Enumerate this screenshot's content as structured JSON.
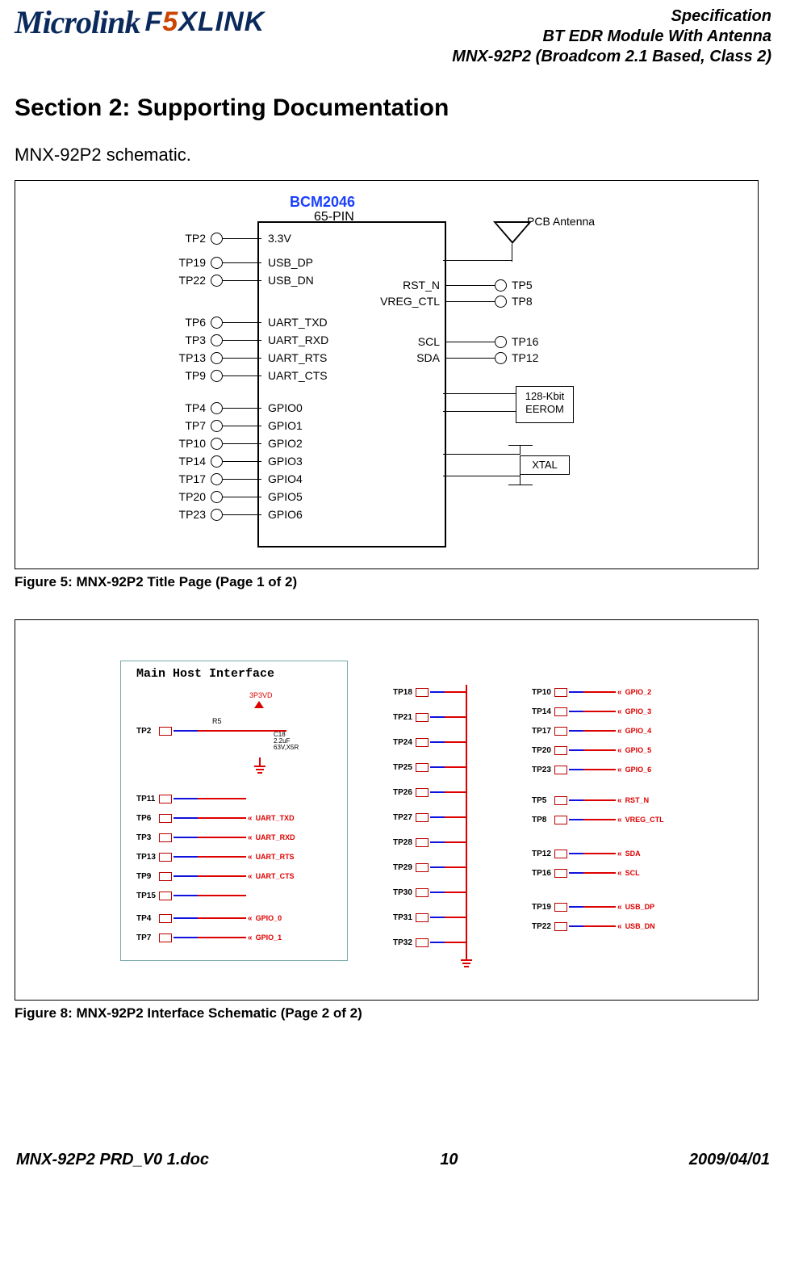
{
  "header": {
    "logo1": "Microlink",
    "logo2_prefix": "F",
    "logo2_5": "5",
    "logo2_suffix": "XLINK",
    "line1": "Specification",
    "line2": "BT EDR Module With Antenna",
    "line3": "MNX-92P2 (Broadcom 2.1  Based, Class 2)"
  },
  "section_title": "Section 2: Supporting Documentation",
  "subhead": "MNX-92P2 schematic.",
  "fig1": {
    "chip_title": "BCM2046",
    "chip_sub": "65-PIN",
    "ant_label": "PCB Antenna",
    "left_pins": [
      {
        "tp": "TP2",
        "name": "3.3V"
      },
      {
        "tp": "TP19",
        "name": "USB_DP"
      },
      {
        "tp": "TP22",
        "name": "USB_DN"
      },
      {
        "tp": "TP6",
        "name": "UART_TXD"
      },
      {
        "tp": "TP3",
        "name": "UART_RXD"
      },
      {
        "tp": "TP13",
        "name": "UART_RTS"
      },
      {
        "tp": "TP9",
        "name": "UART_CTS"
      },
      {
        "tp": "TP4",
        "name": "GPIO0"
      },
      {
        "tp": "TP7",
        "name": "GPIO1"
      },
      {
        "tp": "TP10",
        "name": "GPIO2"
      },
      {
        "tp": "TP14",
        "name": "GPIO3"
      },
      {
        "tp": "TP17",
        "name": "GPIO4"
      },
      {
        "tp": "TP20",
        "name": "GPIO5"
      },
      {
        "tp": "TP23",
        "name": "GPIO6"
      }
    ],
    "right_pins": [
      {
        "name": "RST_N",
        "tp": "TP5"
      },
      {
        "name": "VREG_CTL",
        "tp": "TP8"
      },
      {
        "name": "SCL",
        "tp": "TP16"
      },
      {
        "name": "SDA",
        "tp": "TP12"
      }
    ],
    "eerom": "128-Kbit\nEEROM",
    "xtal": "XTAL",
    "caption": "Figure 5: MNX-92P2 Title Page (Page 1 of 2)"
  },
  "fig2": {
    "box_title": "Main Host Interface",
    "r_label": "R5",
    "v_label": "3P3VD",
    "cap_label": "C18\n2.2uF\n63V,X5R",
    "col1": [
      {
        "tp": "TP2",
        "sig": ""
      },
      {
        "tp": "TP11",
        "sig": ""
      },
      {
        "tp": "TP6",
        "sig": "UART_TXD"
      },
      {
        "tp": "TP3",
        "sig": "UART_RXD"
      },
      {
        "tp": "TP13",
        "sig": "UART_RTS"
      },
      {
        "tp": "TP9",
        "sig": "UART_CTS"
      },
      {
        "tp": "TP15",
        "sig": ""
      },
      {
        "tp": "TP4",
        "sig": "GPIO_0"
      },
      {
        "tp": "TP7",
        "sig": "GPIO_1"
      }
    ],
    "col2": [
      "TP18",
      "TP21",
      "TP24",
      "TP25",
      "TP26",
      "TP27",
      "TP28",
      "TP29",
      "TP30",
      "TP31",
      "TP32"
    ],
    "col3": [
      {
        "tp": "TP10",
        "sig": "GPIO_2"
      },
      {
        "tp": "TP14",
        "sig": "GPIO_3"
      },
      {
        "tp": "TP17",
        "sig": "GPIO_4"
      },
      {
        "tp": "TP20",
        "sig": "GPIO_5"
      },
      {
        "tp": "TP23",
        "sig": "GPIO_6"
      },
      {
        "tp": "TP5",
        "sig": "RST_N"
      },
      {
        "tp": "TP8",
        "sig": "VREG_CTL"
      },
      {
        "tp": "TP12",
        "sig": "SDA"
      },
      {
        "tp": "TP16",
        "sig": "SCL"
      },
      {
        "tp": "TP19",
        "sig": "USB_DP"
      },
      {
        "tp": "TP22",
        "sig": "USB_DN"
      }
    ],
    "caption": "Figure 8: MNX-92P2 Interface Schematic (Page 2 of 2)"
  },
  "footer": {
    "left": "MNX-92P2 PRD_V0 1.doc",
    "center": "10",
    "right": "2009/04/01"
  }
}
